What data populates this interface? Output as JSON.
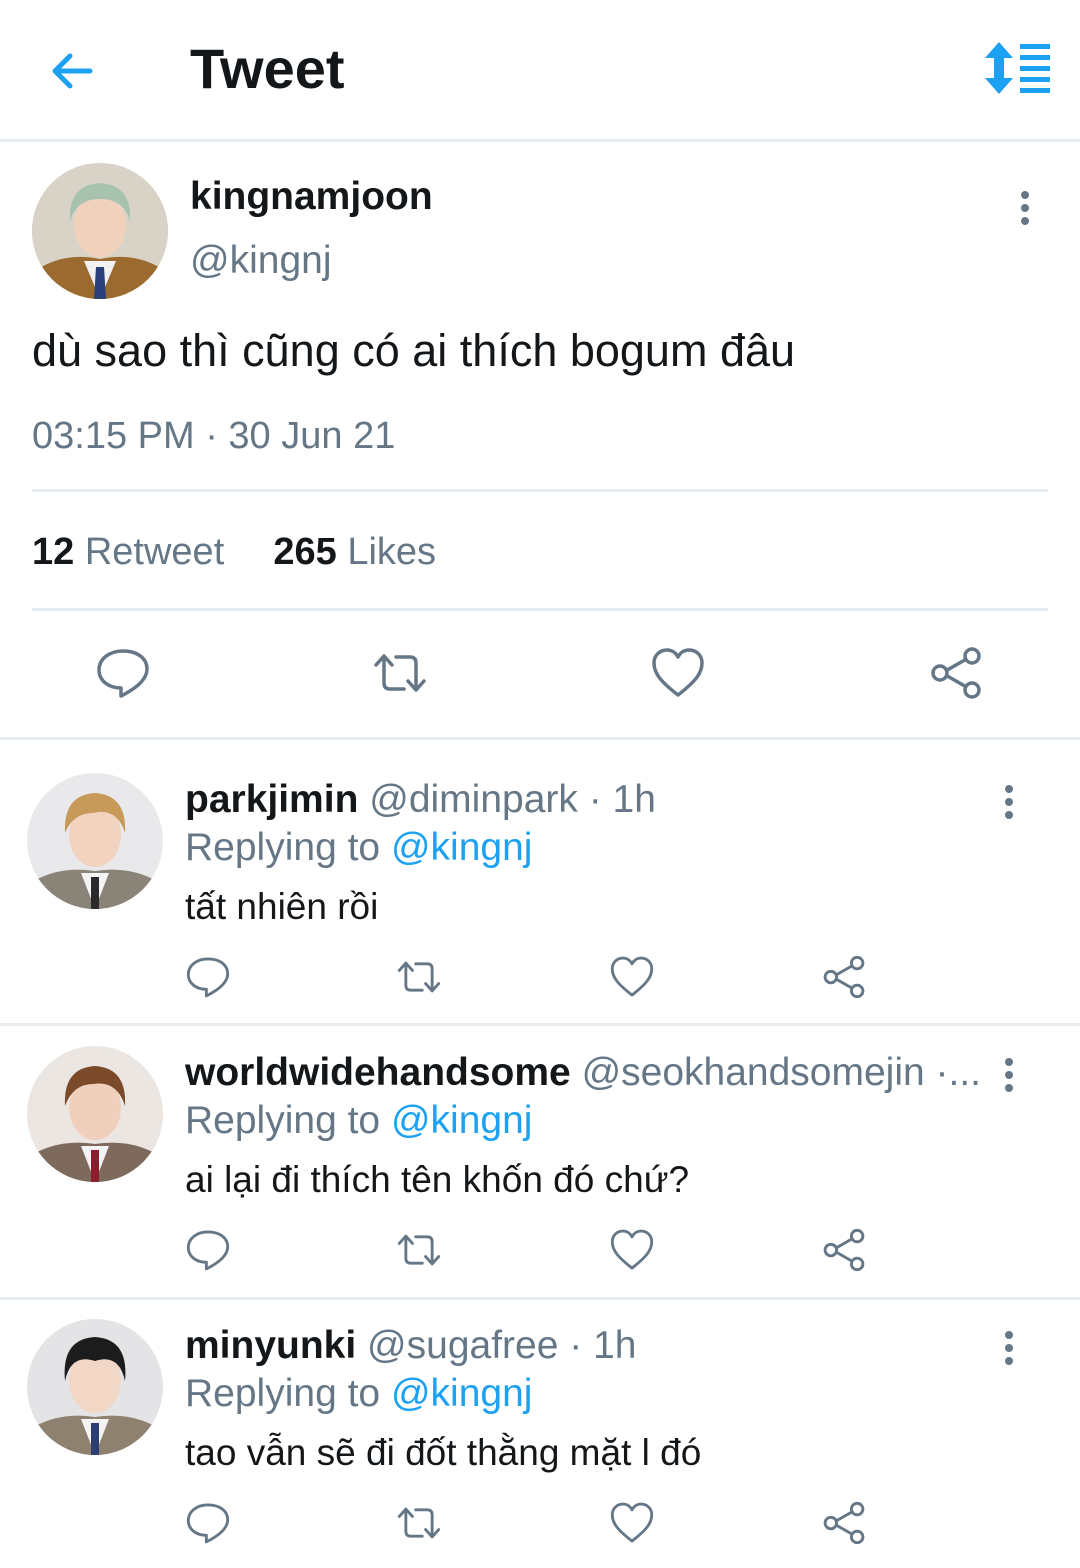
{
  "header": {
    "title": "Tweet",
    "back_icon": "arrow-left-icon",
    "sort_icon": "sort-lines-icon"
  },
  "colors": {
    "accent": "#1da1f2",
    "muted": "#657786",
    "divider": "#e6ecf0",
    "text": "#14171a"
  },
  "main_tweet": {
    "display_name": "kingnamjoon",
    "handle": "@kingnj",
    "text": "dù sao thì cũng có ai thích bogum đâu",
    "timestamp": "03:15 PM · 30 Jun 21",
    "retweet_count": "12",
    "retweet_label": "Retweet",
    "like_count": "265",
    "like_label": "Likes"
  },
  "replies": [
    {
      "display_name": "parkjimin",
      "meta": "@diminpark · 1h",
      "replying_prefix": "Replying to",
      "replying_to": "@kingnj",
      "text": "tất nhiên rồi"
    },
    {
      "display_name": "worldwidehandsome",
      "meta": "@seokhandsomejin ·...",
      "replying_prefix": "Replying to",
      "replying_to": "@kingnj",
      "text": "ai lại đi thích tên khốn đó chứ?"
    },
    {
      "display_name": "minyunki",
      "meta": "@sugafree · 1h",
      "replying_prefix": "Replying to",
      "replying_to": "@kingnj",
      "text": "tao vẫn sẽ đi đốt thằng mặt l đó"
    }
  ]
}
